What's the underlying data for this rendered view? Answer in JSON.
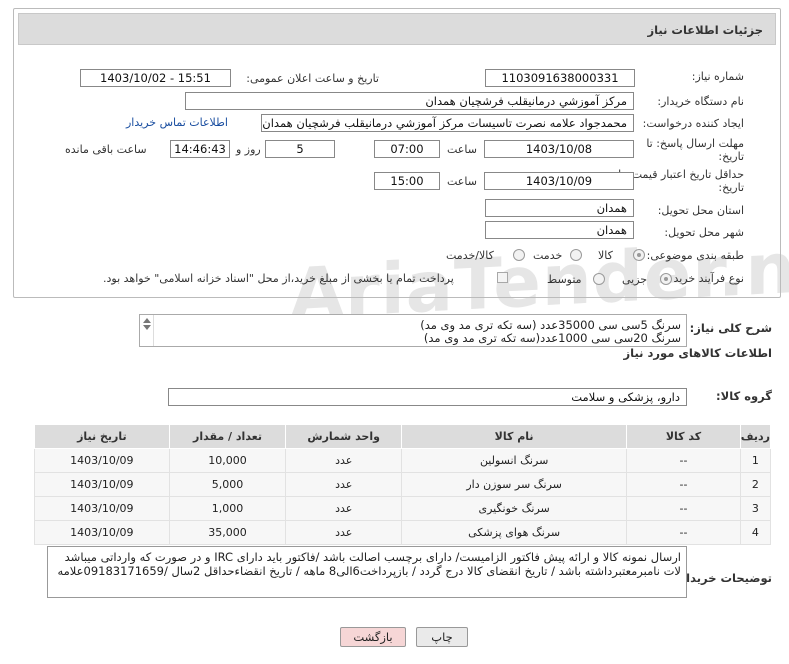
{
  "page_title": "جزئیات اطلاعات نیاز",
  "watermark": "AriaTender.net",
  "fields": {
    "need_number_label": "شماره نیاز:",
    "need_number": "1103091638000331",
    "announce_label": "تاریخ و ساعت اعلان عمومی:",
    "announce_value": "1403/10/02 - 15:51",
    "buyer_org_label": "نام دستگاه خریدار:",
    "buyer_org": "مرکز آموزشي درمانيقلب فرشچيان همدان",
    "requester_label": "ایجاد کننده درخواست:",
    "requester": "محمدجواد علامه نصرت تاسیسات مرکز آموزشي درمانيقلب فرشچيان همدان",
    "buyer_contact_link": "اطلاعات تماس خریدار",
    "reply_deadline_label_1": "مهلت ارسال پاسخ: تا",
    "reply_deadline_label_2": "تاریخ:",
    "reply_date": "1403/10/08",
    "time_label": "ساعت",
    "reply_time": "07:00",
    "days_value": "5",
    "days_label": "روز و",
    "remaining_time": "14:46:43",
    "remaining_label": "ساعت باقی مانده",
    "validity_label_1": "حداقل تاریخ اعتبار قیمت: تا",
    "validity_label_2": "تاریخ:",
    "validity_date": "1403/10/09",
    "validity_time": "15:00",
    "province_label": "استان محل تحویل:",
    "province": "همدان",
    "city_label": "شهر محل تحویل:",
    "city": "همدان",
    "category_label": "طبقه بندی موضوعی:",
    "category_options": [
      "کالا",
      "خدمت",
      "کالا/خدمت"
    ],
    "category_selected": "کالا",
    "purchase_type_label": "نوع فرآیند خرید :",
    "purchase_options": [
      "جزیی",
      "متوسط"
    ],
    "purchase_selected": "جزیی",
    "payment_note": "پرداخت تمام یا بخشی از مبلغ خرید،از محل \"اسناد خزانه اسلامی\" خواهد بود."
  },
  "summary": {
    "label": "شرح کلی نیاز:",
    "line1": "سرنگ 5سی سی  35000عدد (سه تکه تری مد وی مد)",
    "line2": "سرنگ 20سی سی 1000عدد(سه تکه تری مد وی مد)"
  },
  "goods_section_title": "اطلاعات کالاهای مورد نیاز",
  "goods_group": {
    "label": "گروه کالا:",
    "value": "دارو، پزشکی و سلامت"
  },
  "table": {
    "headers": [
      "ردیف",
      "کد کالا",
      "نام کالا",
      "واحد شمارش",
      "تعداد / مقدار",
      "تاریخ نیاز"
    ],
    "rows": [
      [
        "1",
        "--",
        "سرنگ انسولین",
        "عدد",
        "10,000",
        "1403/10/09"
      ],
      [
        "2",
        "--",
        "سرنگ سر سوزن دار",
        "عدد",
        "5,000",
        "1403/10/09"
      ],
      [
        "3",
        "--",
        "سرنگ خونگیری",
        "عدد",
        "1,000",
        "1403/10/09"
      ],
      [
        "4",
        "--",
        "سرنگ هوای پزشکی",
        "عدد",
        "35,000",
        "1403/10/09"
      ]
    ]
  },
  "buyer_notes": {
    "label": "توضیحات خریدار:",
    "text": "ارسال نمونه کالا و ارائه پیش فاکتور الزامیست/ دارای برچسب اصالت باشد /فاکتور باید دارای IRC و در صورت که وارداتی میباشد لات نامبرمعتبرداشته  باشد / تاریخ انقضای کالا درج گردد / بازپرداخت6الی8 ماهه / تاریخ انقضاءحداقل 2سال /09183171659علامه"
  },
  "buttons": {
    "print": "چاپ",
    "back": "بازگشت"
  },
  "colors": {
    "header_bg": "#dcdcdc",
    "link": "#1a4ea0",
    "back_button_bg": "#f6d6d6",
    "print_button_bg": "#eaeaea"
  }
}
